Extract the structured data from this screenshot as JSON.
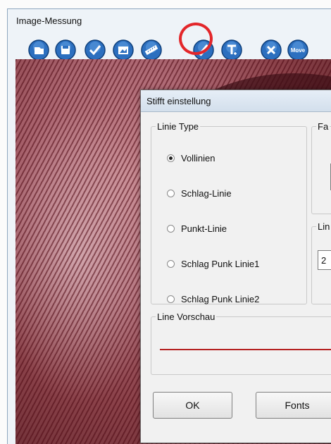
{
  "window": {
    "title": "Image-Messung"
  },
  "toolbar": {
    "buttons": [
      {
        "name": "open-icon"
      },
      {
        "name": "save-icon"
      },
      {
        "name": "check-icon"
      },
      {
        "name": "edit-image-icon"
      },
      {
        "name": "ruler-icon"
      },
      {
        "name": "pen-icon",
        "highlighted": true
      },
      {
        "name": "text-icon"
      },
      {
        "name": "close-icon"
      },
      {
        "name": "move-icon",
        "label": "Move"
      }
    ]
  },
  "dialog": {
    "title": "Stifft einstellung",
    "line_type": {
      "legend": "Linie Type",
      "options": [
        {
          "label": "Vollinien",
          "checked": true
        },
        {
          "label": "Schlag-Linie",
          "checked": false
        },
        {
          "label": "Punkt-Linie",
          "checked": false
        },
        {
          "label": "Schlag Punk Linie1",
          "checked": false
        },
        {
          "label": "Schlag Punk Linie2",
          "checked": false
        }
      ]
    },
    "color_group": {
      "legend": "Fa"
    },
    "width_group": {
      "legend": "Lin",
      "value": "2"
    },
    "preview": {
      "legend": "Line Vorschau",
      "line_color": "#b52020"
    },
    "buttons": {
      "ok": "OK",
      "fonts": "Fonts"
    }
  },
  "colors": {
    "highlight": "#e3262a",
    "toolbar_icon": "#1f5fa8"
  }
}
